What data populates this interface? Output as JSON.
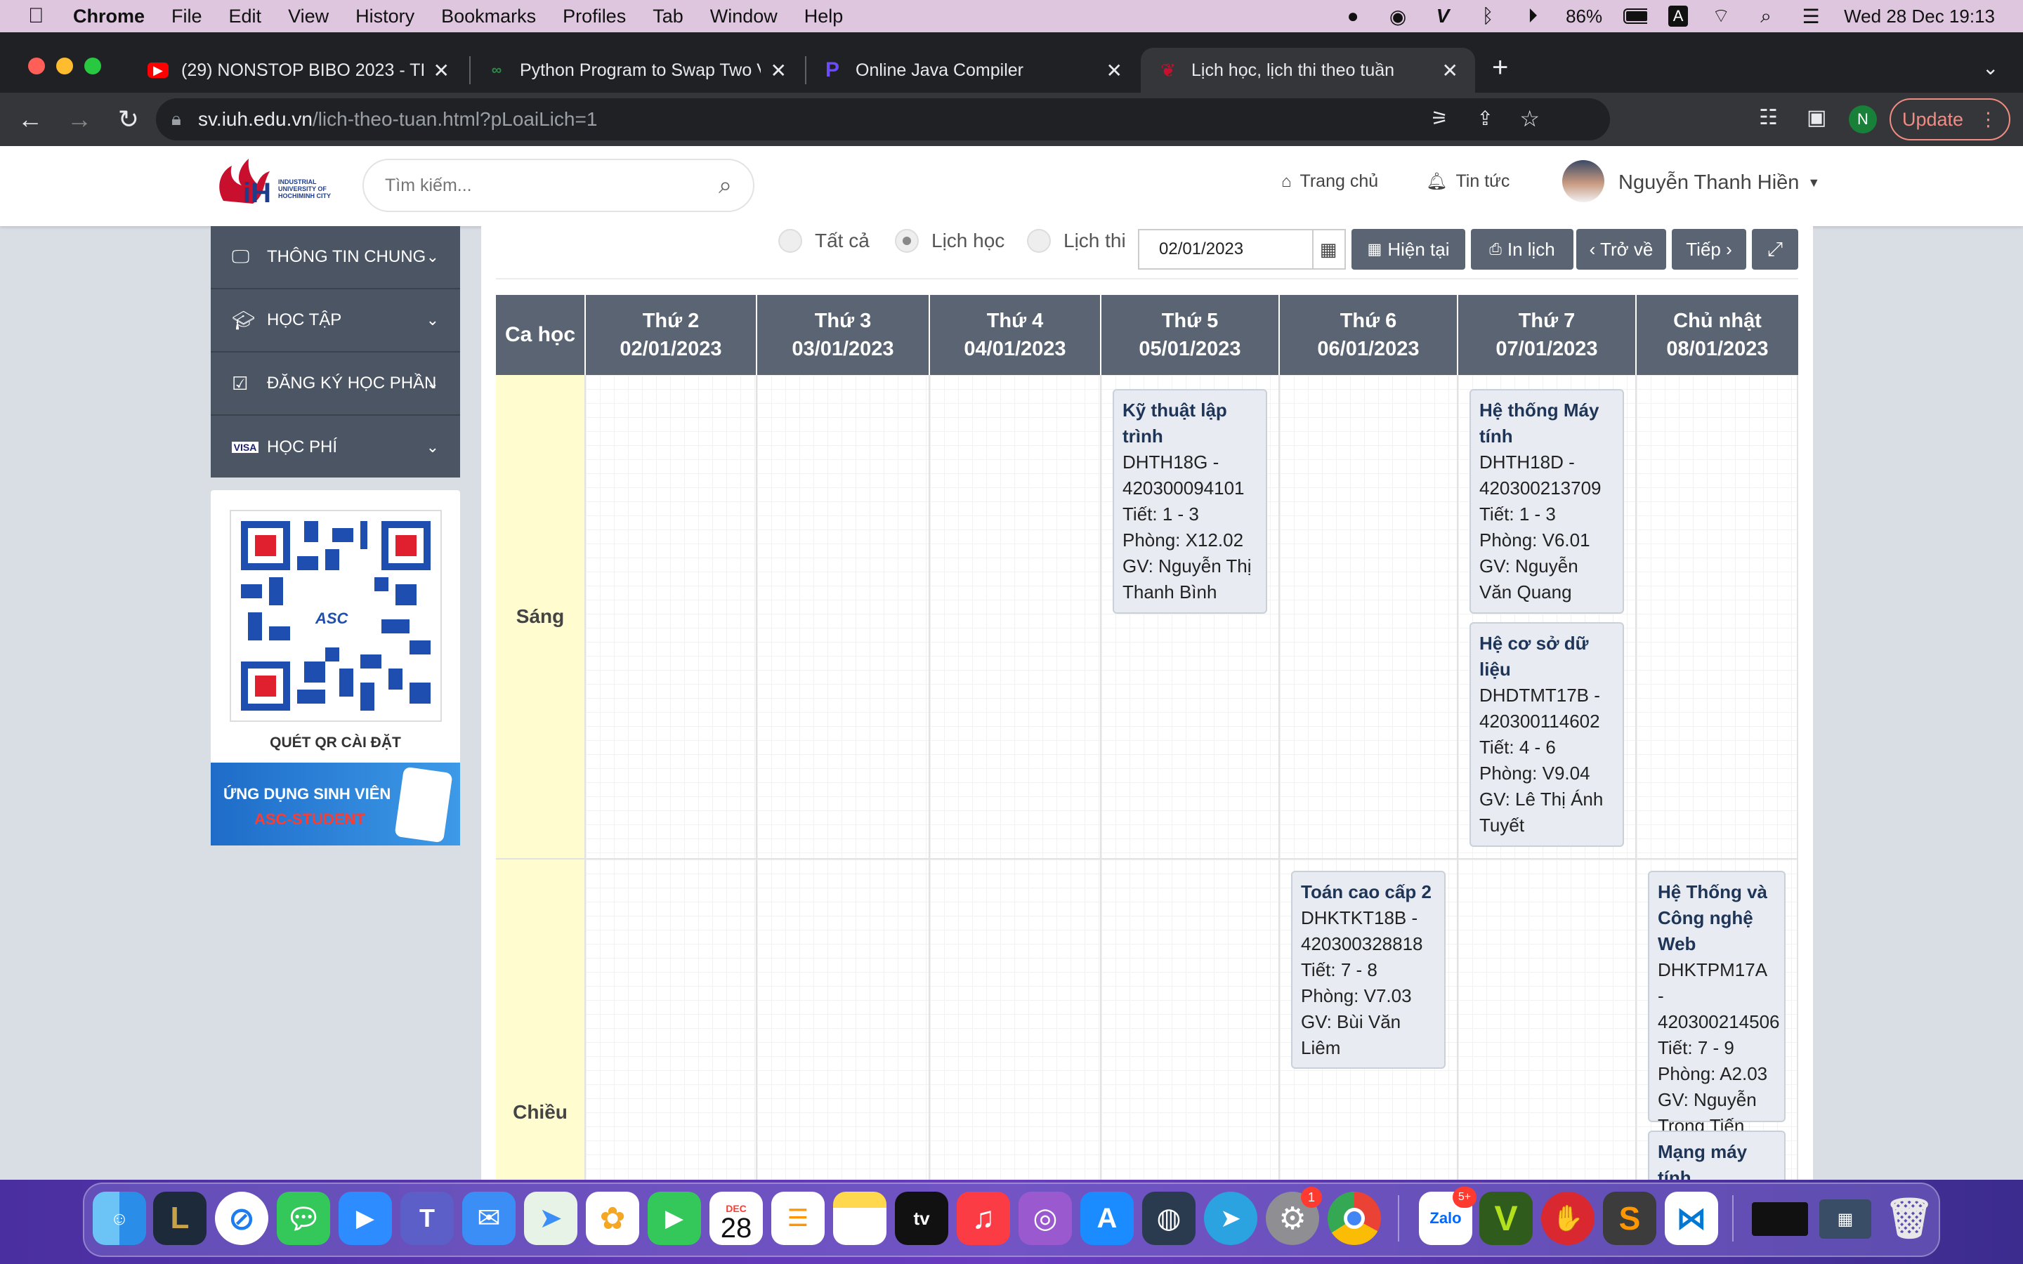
{
  "menubar": {
    "app": "Chrome",
    "items": [
      "File",
      "Edit",
      "View",
      "History",
      "Bookmarks",
      "Profiles",
      "Tab",
      "Window",
      "Help"
    ],
    "battery": "86%",
    "datetime": "Wed 28 Dec  19:13"
  },
  "tabs": [
    {
      "title": "(29) NONSTOP BIBO 2023 - TI",
      "icon": "youtube-icon",
      "color": "#ff0000"
    },
    {
      "title": "Python Program to Swap Two V",
      "icon": "geeks-icon",
      "color": "#2f8d46"
    },
    {
      "title": "Online Java Compiler",
      "icon": "programiz-icon",
      "color": "#6d4aff"
    },
    {
      "title": "Lịch học, lịch thi theo tuần",
      "icon": "iuh-icon",
      "color": "#c8102e"
    }
  ],
  "address": {
    "host": "sv.iuh.edu.vn",
    "path": "/lich-theo-tuan.html?pLoaiLich=1"
  },
  "toolbar": {
    "update_label": "Update",
    "profile_initial": "N"
  },
  "site": {
    "logo_text": "INDUSTRIAL UNIVERSITY OF HOCHIMINH CITY",
    "search_placeholder": "Tìm kiếm...",
    "nav_home": "Trang chủ",
    "nav_news": "Tin tức",
    "user_name": "Nguyễn Thanh Hiền"
  },
  "sidebar": {
    "items": [
      {
        "label": "THÔNG TIN CHUNG",
        "icon": "monitor-icon"
      },
      {
        "label": "HỌC TẬP",
        "icon": "graduation-cap-icon"
      },
      {
        "label": "ĐĂNG KÝ HỌC PHẦN",
        "icon": "checkbox-icon"
      },
      {
        "label": "HỌC PHÍ",
        "icon": "visa-card-icon"
      }
    ],
    "qr_label": "QUÉT QR CÀI ĐẶT",
    "qr_center": "ASC",
    "banner_line1": "ỨNG DỤNG SINH VIÊN",
    "banner_line2": "ASC-STUDENT"
  },
  "controls": {
    "radio_all": "Tất cả",
    "radio_study": "Lịch học",
    "radio_exam": "Lịch thi",
    "date_value": "02/01/2023",
    "btn_current": "Hiện tại",
    "btn_print": "In lịch",
    "btn_back": "‹ Trở về",
    "btn_next": "Tiếp ›"
  },
  "schedule": {
    "shift_header": "Ca học",
    "days": [
      {
        "name": "Thứ 2",
        "date": "02/01/2023"
      },
      {
        "name": "Thứ 3",
        "date": "03/01/2023"
      },
      {
        "name": "Thứ 4",
        "date": "04/01/2023"
      },
      {
        "name": "Thứ 5",
        "date": "05/01/2023"
      },
      {
        "name": "Thứ 6",
        "date": "06/01/2023"
      },
      {
        "name": "Thứ 7",
        "date": "07/01/2023"
      },
      {
        "name": "Chủ nhật",
        "date": "08/01/2023"
      }
    ],
    "shifts": [
      "Sáng",
      "Chiều"
    ],
    "classes": [
      {
        "title": "Kỹ thuật lập trình",
        "class_code": "DHTH18G - 420300094101",
        "periods": "Tiết: 1 - 3",
        "room": "Phòng: X12.02",
        "teacher": "GV: Nguyễn Thị Thanh Bình"
      },
      {
        "title": "Hệ thống Máy tính",
        "class_code": "DHTH18D - 420300213709",
        "periods": "Tiết: 1 - 3",
        "room": "Phòng: V6.01",
        "teacher": "GV: Nguyễn Văn Quang"
      },
      {
        "title": "Hệ cơ sở dữ liệu",
        "class_code": "DHDTMT17B - 420300114602",
        "periods": "Tiết: 4 - 6",
        "room": "Phòng: V9.04",
        "teacher": "GV: Lê Thị Ánh Tuyết"
      },
      {
        "title": "Toán cao cấp 2",
        "class_code": "DHKTKT18B - 420300328818",
        "periods": "Tiết: 7 - 8",
        "room": "Phòng: V7.03",
        "teacher": "GV: Bùi Văn Liêm"
      },
      {
        "title": "Hệ Thống và Công nghệ Web",
        "class_code": "DHKTPM17A - 420300214506",
        "periods": "Tiết: 7 - 9",
        "room": "Phòng: A2.03",
        "teacher": "GV: Nguyễn Trọng Tiến"
      },
      {
        "title": "Mạng máy tính",
        "class_code": "",
        "periods": "",
        "room": "",
        "teacher": ""
      }
    ]
  },
  "dock": {
    "calendar_month": "DEC",
    "calendar_day": "28",
    "zalo_badge": "5+",
    "settings_badge": "1"
  }
}
